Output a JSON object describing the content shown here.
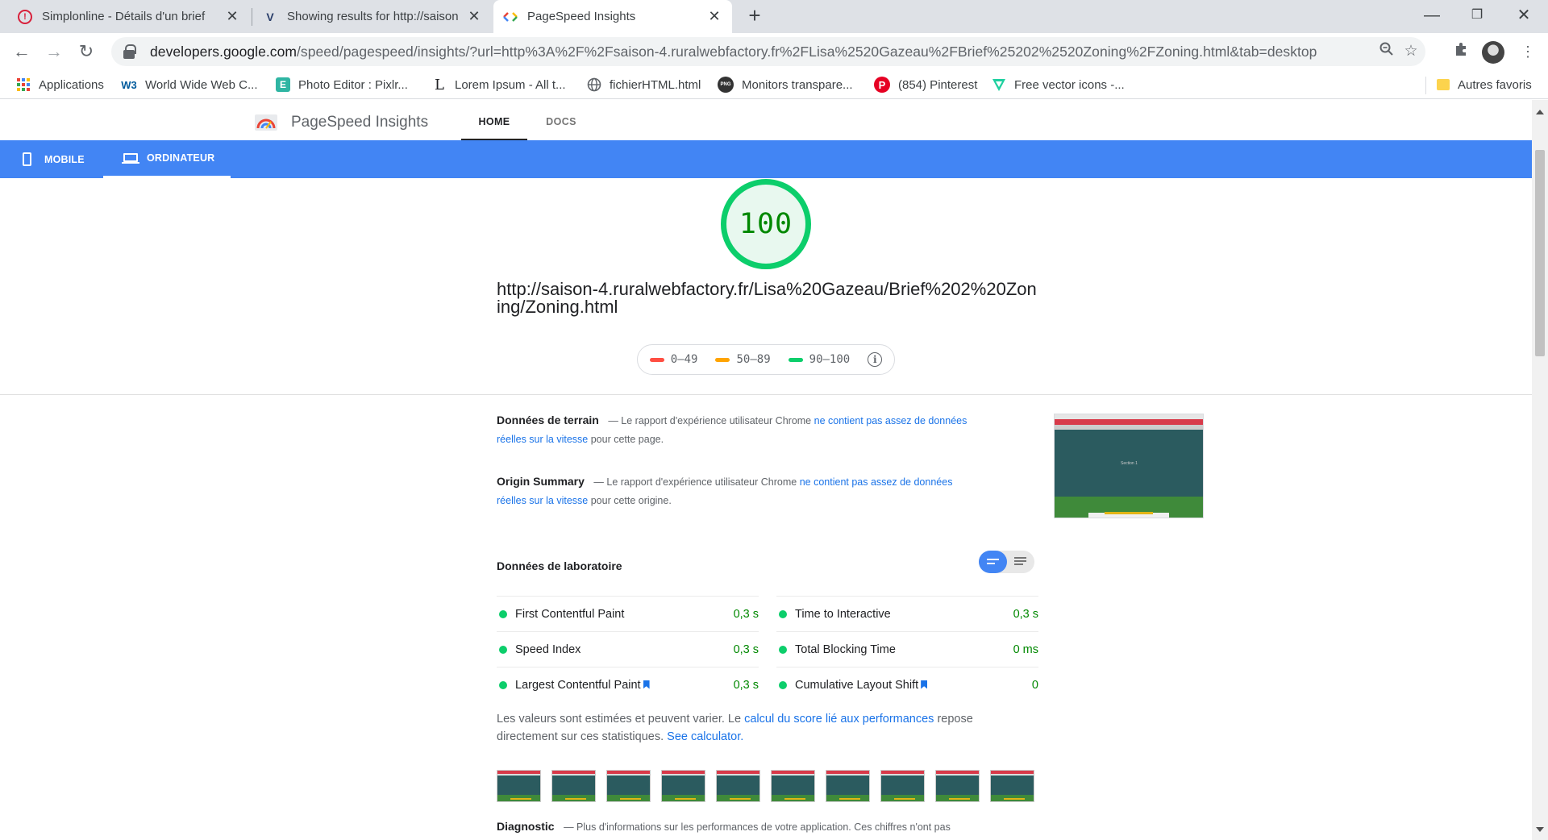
{
  "browser": {
    "tabs": [
      {
        "title": "Simplonline - Détails d'un brief",
        "favicon": "simplon-icon"
      },
      {
        "title": "Showing results for http://saison",
        "favicon": "validator-icon"
      },
      {
        "title": "PageSpeed Insights",
        "favicon": "pagespeed-icon"
      }
    ],
    "url_host": "developers.google.com",
    "url_path": "/speed/pagespeed/insights/?url=http%3A%2F%2Fsaison-4.ruralwebfactory.fr%2FLisa%2520Gazeau%2FBrief%25202%2520Zoning%2FZoning.html&tab=desktop",
    "bookmarks": [
      {
        "label": "Applications",
        "icon": "apps-grid-icon"
      },
      {
        "label": "World Wide Web C...",
        "icon": "w3c-icon"
      },
      {
        "label": "Photo Editor : Pixlr...",
        "icon": "pixlr-icon"
      },
      {
        "label": "Lorem Ipsum - All t...",
        "icon": "lorem-icon"
      },
      {
        "label": "fichierHTML.html",
        "icon": "globe-icon"
      },
      {
        "label": "Monitors transpare...",
        "icon": "png-icon"
      },
      {
        "label": "(854) Pinterest",
        "icon": "pinterest-icon"
      },
      {
        "label": "Free vector icons -...",
        "icon": "flaticon-icon"
      }
    ],
    "other_bookmarks": "Autres favoris"
  },
  "psi": {
    "brand": "PageSpeed Insights",
    "nav_home": "HOME",
    "nav_docs": "DOCS",
    "device_mobile": "MOBILE",
    "device_desktop": "ORDINATEUR",
    "score": "100",
    "tested_url": "http://saison-4.ruralwebfactory.fr/Lisa%20Gazeau/Brief%202%20Zoning/Zoning.html",
    "legend": [
      {
        "range": "0–49",
        "color": "#ff4e42"
      },
      {
        "range": "50–89",
        "color": "#ffa400"
      },
      {
        "range": "90–100",
        "color": "#0cce6b"
      }
    ],
    "field": {
      "title": "Données de terrain",
      "pre": "— Le rapport d'expérience utilisateur Chrome",
      "link": "ne contient pas assez de données réelles sur la vitesse",
      "post": "pour cette page."
    },
    "origin": {
      "title": "Origin Summary",
      "pre": "— Le rapport d'expérience utilisateur Chrome",
      "link": "ne contient pas assez de données réelles sur la vitesse",
      "post": "pour cette origine."
    },
    "thumb_text": "Section 1",
    "lab_title": "Données de laboratoire",
    "metrics_left": [
      {
        "name": "First Contentful Paint",
        "value": "0,3 s"
      },
      {
        "name": "Speed Index",
        "value": "0,3 s"
      },
      {
        "name": "Largest Contentful Paint",
        "value": "0,3 s"
      }
    ],
    "metrics_right": [
      {
        "name": "Time to Interactive",
        "value": "0,3 s"
      },
      {
        "name": "Total Blocking Time",
        "value": "0 ms"
      },
      {
        "name": "Cumulative Layout Shift",
        "value": "0"
      }
    ],
    "note": {
      "pre": "Les valeurs sont estimées et peuvent varier. Le",
      "link1": "calcul du score lié aux performances",
      "mid": "repose directement sur ces statistiques.",
      "link2": "See calculator."
    },
    "diagnostic": {
      "title": "Diagnostic",
      "text": "— Plus d'informations sur les performances de votre application. Ces chiffres n'ont pas"
    },
    "colors": {
      "accent": "#4285f4",
      "pass": "#0cce6b",
      "pass_text": "#008800"
    }
  }
}
